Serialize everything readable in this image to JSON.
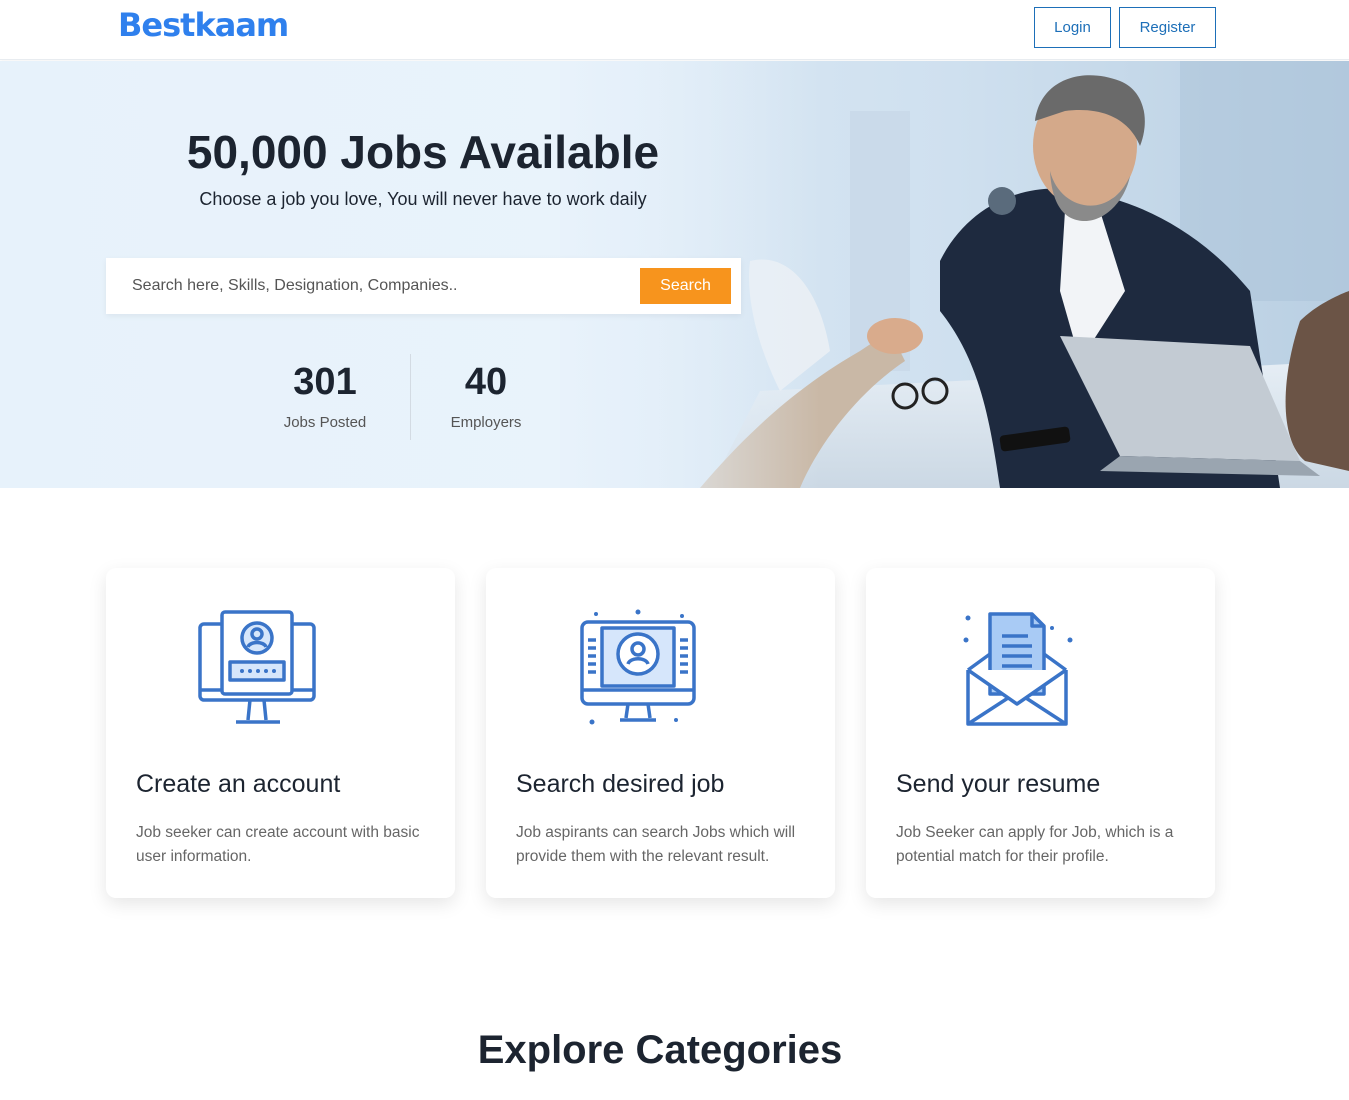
{
  "header": {
    "logo": "Bestkaam",
    "login_label": "Login",
    "register_label": "Register"
  },
  "hero": {
    "title": "50,000 Jobs Available",
    "subtitle": "Choose a job you love, You will never have to work daily",
    "search": {
      "placeholder": "Search here, Skills, Designation, Companies..",
      "button_label": "Search"
    },
    "stats": [
      {
        "value": "301",
        "label": "Jobs Posted"
      },
      {
        "value": "40",
        "label": "Employers"
      }
    ]
  },
  "steps": [
    {
      "icon": "monitor-user-icon",
      "title": "Create an account",
      "text": "Job seeker can create account with basic user information."
    },
    {
      "icon": "monitor-search-icon",
      "title": "Search desired job",
      "text": "Job aspirants can search Jobs which will provide them with the relevant result."
    },
    {
      "icon": "envelope-document-icon",
      "title": "Send your resume",
      "text": "Job Seeker can apply for Job, which is a potential match for their profile."
    }
  ],
  "categories": {
    "title": "Explore Categories"
  },
  "colors": {
    "brand": "#2f80ed",
    "accent": "#f7941d",
    "button_border": "#1d6fb8",
    "icon": "#3a7bd5"
  }
}
